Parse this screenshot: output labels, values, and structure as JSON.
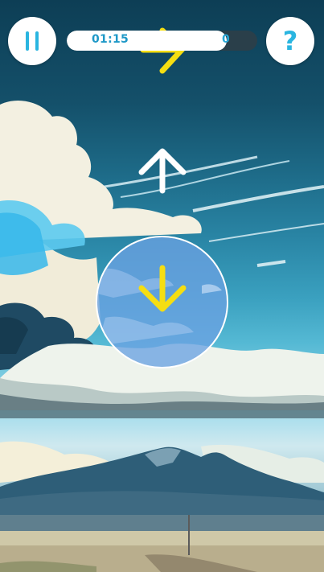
{
  "hud": {
    "timer_text": "01:15",
    "timer_end_text": "0",
    "timer_progress": 0.84,
    "help_label": "?"
  },
  "gameplay": {
    "falling_arrow_direction": "right",
    "falling_arrow_color": "#f5de12",
    "incoming_arrow_direction": "up",
    "incoming_arrow_color": "#ffffff",
    "target_arrow_direction": "down",
    "target_arrow_color": "#f5de12"
  },
  "colors": {
    "accent": "#2ab5e0",
    "timer_track": "#2a3f4a",
    "target_circle": "#6aa2e2"
  }
}
